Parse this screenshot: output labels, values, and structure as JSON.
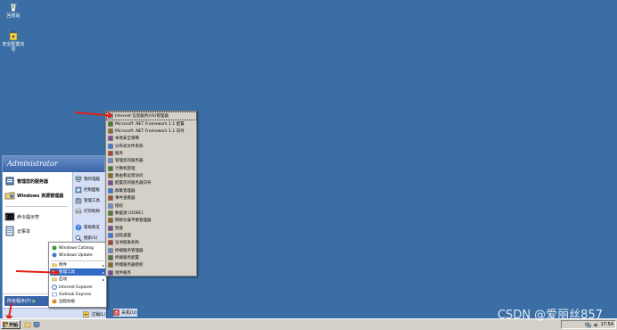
{
  "desktop": {
    "icons": [
      {
        "label": "回收站",
        "icon": "recycle-bin-icon"
      },
      {
        "label": "安全配置向导",
        "icon": "security-config-icon"
      }
    ]
  },
  "start_menu": {
    "user": "Administrator",
    "left_items": [
      {
        "label": "管理您的服务器",
        "icon": "server-manage-icon"
      },
      {
        "label": "Windows 资源管理器",
        "icon": "explorer-icon"
      },
      {
        "label": "命令提示符",
        "icon": "cmd-icon"
      },
      {
        "label": "记事本",
        "icon": "notepad-icon"
      }
    ],
    "right_items": [
      {
        "label": "我的电脑",
        "icon": "my-computer-icon"
      },
      {
        "label": "控制面板",
        "icon": "control-panel-icon"
      },
      {
        "label": "管理工具",
        "icon": "admin-tools-icon"
      },
      {
        "label": "打印机和",
        "icon": "printer-icon"
      },
      {
        "label": "帮助和支",
        "icon": "help-icon"
      },
      {
        "label": "搜索(S)",
        "icon": "search-icon"
      }
    ],
    "all_programs": "所有程序(P)",
    "logoff": "注销(L)",
    "shutdown": "关机(U)"
  },
  "programs_menu": {
    "items": [
      {
        "label": "Windows Catalog",
        "icon": "catalog-icon",
        "arrow": ""
      },
      {
        "label": "Windows Update",
        "icon": "update-icon",
        "arrow": ""
      },
      {
        "label": "附件",
        "icon": "folder-icon",
        "arrow": "▸"
      },
      {
        "label": "管理工具",
        "icon": "folder-icon",
        "arrow": "▸"
      },
      {
        "label": "启动",
        "icon": "folder-icon",
        "arrow": "▸"
      },
      {
        "label": "Internet Explorer",
        "icon": "ie-icon",
        "arrow": ""
      },
      {
        "label": "Outlook Express",
        "icon": "outlook-icon",
        "arrow": ""
      },
      {
        "label": "远程协助",
        "icon": "remote-assist-icon",
        "arrow": ""
      }
    ]
  },
  "admin_menu": {
    "items": [
      {
        "label": "Internet 信息服务(IIS)管理器",
        "icon": "iis-icon"
      },
      {
        "label": "Microsoft .NET Framework 1.1 配置",
        "icon": "dotnet-icon"
      },
      {
        "label": "Microsoft .NET Framework 1.1 向导",
        "icon": "dotnet-icon"
      },
      {
        "label": "本地安全策略",
        "icon": "policy-icon"
      },
      {
        "label": "分布式文件系统",
        "icon": "dfs-icon"
      },
      {
        "label": "服务",
        "icon": "services-icon"
      },
      {
        "label": "管理您的服务器",
        "icon": "server-manage-icon"
      },
      {
        "label": "计算机管理",
        "icon": "computer-mgmt-icon"
      },
      {
        "label": "路由和远程访问",
        "icon": "routing-icon"
      },
      {
        "label": "配置您的服务器向导",
        "icon": "wizard-icon"
      },
      {
        "label": "群集管理器",
        "icon": "cluster-icon"
      },
      {
        "label": "事件查看器",
        "icon": "event-icon"
      },
      {
        "label": "授权",
        "icon": "license-icon"
      },
      {
        "label": "数据源 (ODBC)",
        "icon": "odbc-icon"
      },
      {
        "label": "网络负载平衡管理器",
        "icon": "nlb-icon"
      },
      {
        "label": "性能",
        "icon": "performance-icon"
      },
      {
        "label": "远程桌面",
        "icon": "remote-desktop-icon"
      },
      {
        "label": "证书颁发机构",
        "icon": "certificate-icon"
      },
      {
        "label": "终端服务管理器",
        "icon": "terminal-icon"
      },
      {
        "label": "终端服务配置",
        "icon": "terminal-icon"
      },
      {
        "label": "终端服务器授权",
        "icon": "terminal-icon"
      },
      {
        "label": "组件服务",
        "icon": "component-icon"
      }
    ]
  },
  "taskbar": {
    "start_label": "开始",
    "clock": "17:54"
  },
  "watermark": "CSDN @爱丽丝857",
  "colors": {
    "desktop": "#3a6ea5",
    "arrow": "#e0201a",
    "highlight": "#316ac5"
  }
}
